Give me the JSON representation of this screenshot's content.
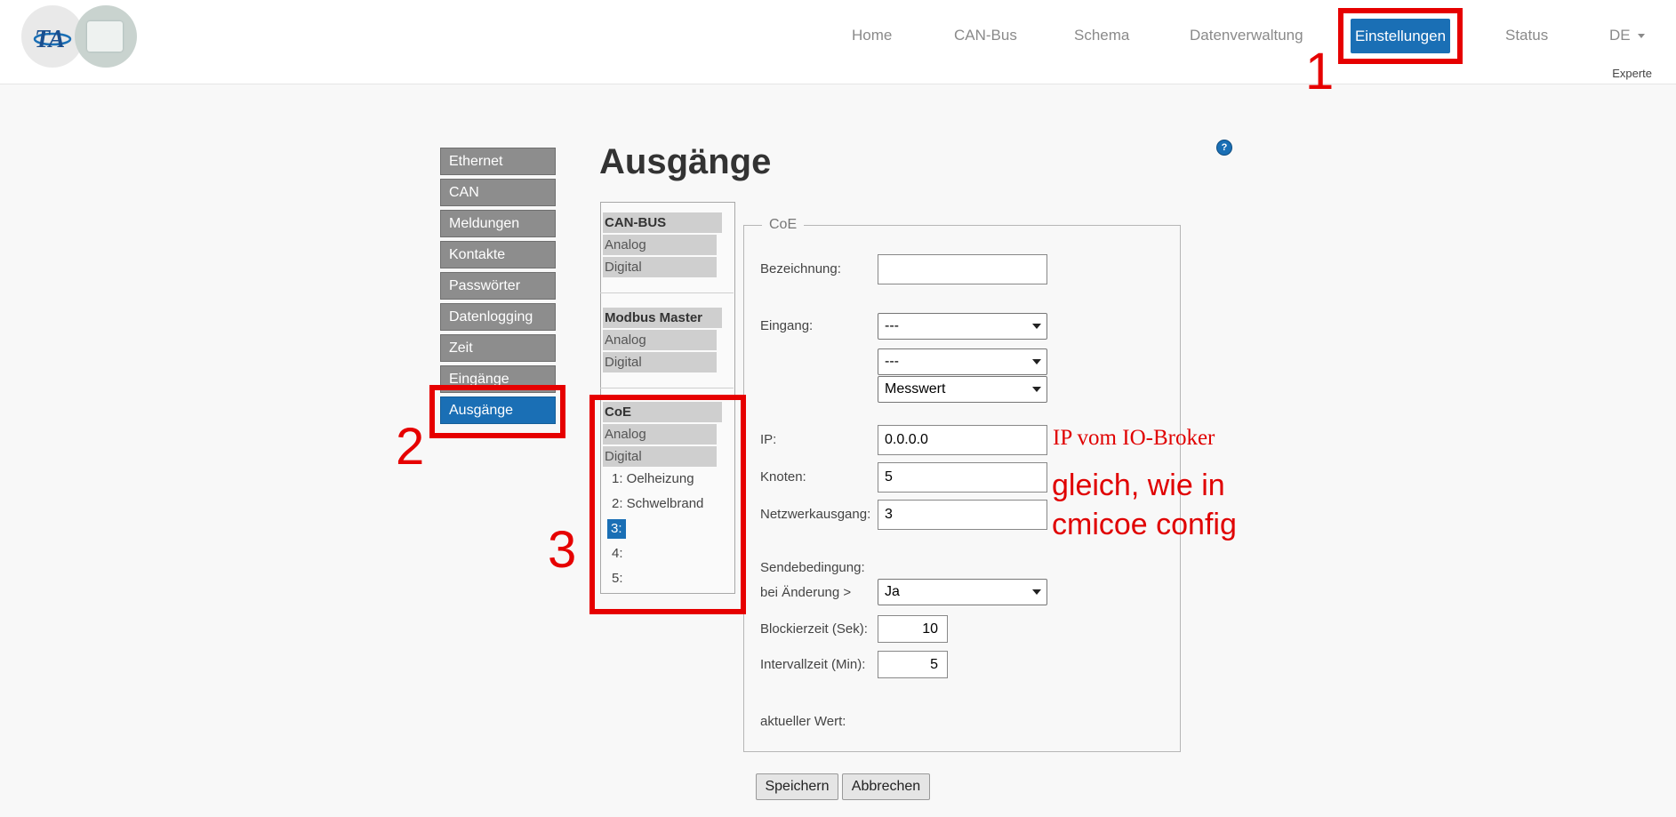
{
  "header": {
    "nav": [
      {
        "label": "Home"
      },
      {
        "label": "CAN-Bus"
      },
      {
        "label": "Schema"
      },
      {
        "label": "Datenverwaltung"
      },
      {
        "label": "Einstellungen",
        "active": true
      },
      {
        "label": "Status"
      }
    ],
    "lang": "DE",
    "mode": "Experte"
  },
  "sidebar": {
    "items": [
      {
        "label": "Ethernet"
      },
      {
        "label": "CAN"
      },
      {
        "label": "Meldungen"
      },
      {
        "label": "Kontakte"
      },
      {
        "label": "Passwörter"
      },
      {
        "label": "Datenlogging"
      },
      {
        "label": "Zeit"
      },
      {
        "label": "Eingänge"
      },
      {
        "label": "Ausgänge",
        "active": true
      }
    ]
  },
  "page": {
    "title": "Ausgänge",
    "help_icon": "?"
  },
  "tree": {
    "groups": [
      {
        "header": "CAN-BUS",
        "subs": [
          "Analog",
          "Digital"
        ]
      },
      {
        "header": "Modbus Master",
        "subs": [
          "Analog",
          "Digital"
        ]
      },
      {
        "header": "CoE",
        "subs": [
          "Analog",
          "Digital"
        ]
      }
    ],
    "coe_digital_items": [
      "1: Oelheizung",
      "2: Schwelbrand",
      "3:",
      "4:",
      "5:"
    ],
    "selected_item": "3:"
  },
  "form": {
    "legend": "CoE",
    "bezeichnung": {
      "label": "Bezeichnung:",
      "value": ""
    },
    "eingang": {
      "label": "Eingang:",
      "select1": "---",
      "select2": "---",
      "select3": "Messwert"
    },
    "ip": {
      "label": "IP:",
      "value": "0.0.0.0"
    },
    "knoten": {
      "label": "Knoten:",
      "value": "5"
    },
    "netzwerkausgang": {
      "label": "Netzwerkausgang:",
      "value": "3"
    },
    "sendebedingung": {
      "label": "Sendebedingung:",
      "sublabel": "bei Änderung >",
      "value": "Ja"
    },
    "blockierzeit": {
      "label": "Blockierzeit (Sek):",
      "value": "10"
    },
    "intervallzeit": {
      "label": "Intervallzeit (Min):",
      "value": "5"
    },
    "aktueller_wert": {
      "label": "aktueller Wert:"
    }
  },
  "buttons": {
    "save": "Speichern",
    "cancel": "Abbrechen"
  },
  "annotations": {
    "markers": [
      "1",
      "2",
      "3"
    ],
    "note_ip": "IP vom IO-Broker",
    "note_same_line1": "gleich, wie in",
    "note_same_line2": "cmicoe config",
    "color": "#e60000"
  },
  "colors": {
    "accent": "#1a6fb5",
    "sidebar_bg": "#8d8d8d",
    "tree_bg": "#cfcfcf"
  }
}
